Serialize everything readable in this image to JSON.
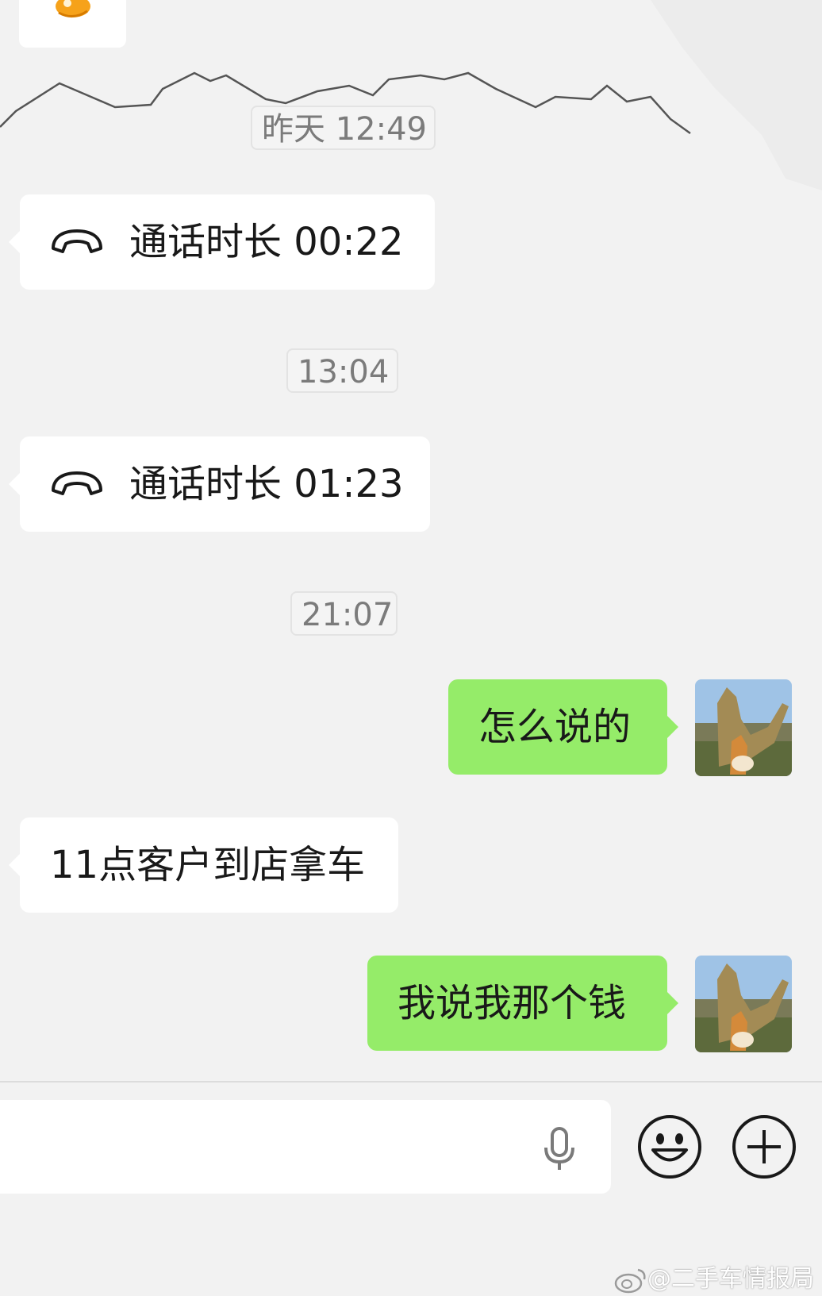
{
  "timestamps": [
    "昨天 12:49",
    "13:04",
    "21:07"
  ],
  "calls": [
    {
      "icon": "phone-hangup-icon",
      "label": "通话时长 00:22"
    },
    {
      "icon": "phone-hangup-icon",
      "label": "通话时长 01:23"
    }
  ],
  "messages": [
    {
      "direction": "out",
      "text": "怎么说的"
    },
    {
      "direction": "in",
      "text": "11点客户到店拿车"
    },
    {
      "direction": "out",
      "text": "我说我那个钱"
    }
  ],
  "input_bar": {
    "text_value": "",
    "icons": [
      "microphone-icon",
      "emoji-icon",
      "plus-icon"
    ]
  },
  "watermark": "@二手车情报局",
  "colors": {
    "background": "#f2f2f2",
    "incoming_bubble": "#ffffff",
    "outgoing_bubble": "#95ec69"
  }
}
